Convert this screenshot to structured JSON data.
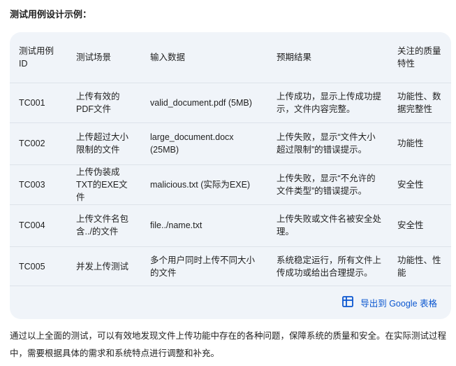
{
  "heading": "测试用例设计示例：",
  "table": {
    "headers": [
      "测试用例ID",
      "测试场景",
      "输入数据",
      "预期结果",
      "关注的质量特性"
    ],
    "rows": [
      [
        "TC001",
        "上传有效的PDF文件",
        "valid_document.pdf (5MB)",
        "上传成功，显示上传成功提示，文件内容完整。",
        "功能性、数据完整性"
      ],
      [
        "TC002",
        "上传超过大小限制的文件",
        "large_document.docx (25MB)",
        "上传失败，显示“文件大小超过限制”的错误提示。",
        "功能性"
      ],
      [
        "TC003",
        "上传伪装成TXT的EXE文件",
        "malicious.txt (实际为EXE)",
        "上传失败，显示“不允许的文件类型”的错误提示。",
        "安全性"
      ],
      [
        "TC004",
        "上传文件名包含../的文件",
        "file../name.txt",
        "上传失败或文件名被安全处理。",
        "安全性"
      ],
      [
        "TC005",
        "并发上传测试",
        "多个用户同时上传不同大小的文件",
        "系统稳定运行，所有文件上传成功或给出合理提示。",
        "功能性、性能"
      ]
    ]
  },
  "export": {
    "label": "导出到 Google 表格",
    "icon": "table-grid-icon",
    "color": "#0b57d0"
  },
  "summary": "通过以上全面的测试，可以有效地发现文件上传功能中存在的各种问题，保障系统的质量和安全。在实际测试过程中，需要根据具体的需求和系统特点进行调整和补充。"
}
